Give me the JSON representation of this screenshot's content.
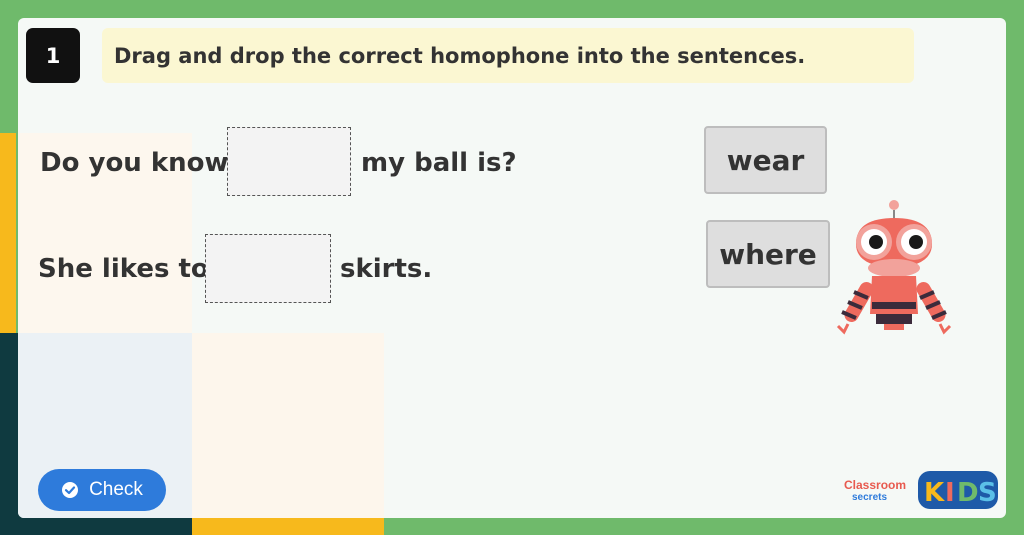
{
  "question": {
    "number": "1",
    "instruction": "Drag and drop the correct homophone into the sentences."
  },
  "sentences": [
    {
      "before": "Do you know",
      "after": "my ball is?"
    },
    {
      "before": "She likes to",
      "after": "skirts."
    }
  ],
  "word_options": [
    "wear",
    "where"
  ],
  "check_button": {
    "label": "Check",
    "icon": "check-circle-icon"
  },
  "branding": {
    "logo_text": "Classroom secrets",
    "kids_text": "KIDS"
  },
  "colors": {
    "background_green": "#6fba6b",
    "yellow": "#f7b91c",
    "dark_teal": "#0f3a40",
    "button_blue": "#2e7bdb",
    "robot_coral": "#ee6a5e"
  }
}
